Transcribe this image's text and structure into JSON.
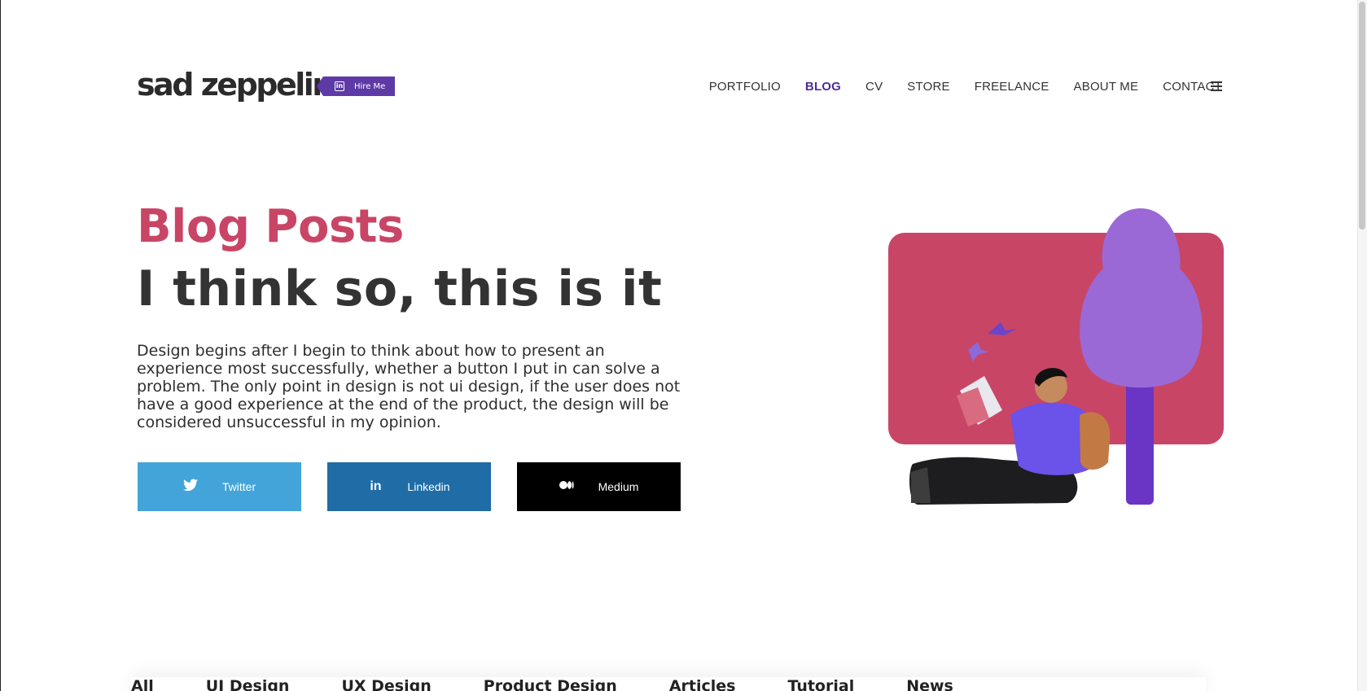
{
  "header": {
    "logo": "sad zeppelins",
    "hire_label": "Hire Me",
    "nav": [
      {
        "label": "PORTFOLIO",
        "active": false
      },
      {
        "label": "BLOG",
        "active": true
      },
      {
        "label": "CV",
        "active": false
      },
      {
        "label": "STORE",
        "active": false
      },
      {
        "label": "FREELANCE",
        "active": false
      },
      {
        "label": "ABOUT ME",
        "active": false
      },
      {
        "label": "CONTACT",
        "active": false
      }
    ]
  },
  "hero": {
    "title": "Blog Posts",
    "subtitle": "I think so, this is it",
    "description": "Design begins after I begin to think about how to present an experience most successfully, whether a button I put in can solve a problem. The only point in design is not ui design, if the user does not have a good experience at the end of the product, the design will be considered unsuccessful in my opinion.",
    "social": [
      {
        "label": "Twitter",
        "icon": "twitter-icon",
        "color": "#42a4d9"
      },
      {
        "label": "Linkedin",
        "icon": "linkedin-icon",
        "color": "#1f6ca6"
      },
      {
        "label": "Medium",
        "icon": "medium-icon",
        "color": "#000000"
      }
    ]
  },
  "colors": {
    "accent": "#c94566",
    "brand_purple": "#5e3aa6"
  },
  "tabs": [
    "All",
    "UI Design",
    "UX Design",
    "Product Design",
    "Articles",
    "Tutorial",
    "News"
  ]
}
